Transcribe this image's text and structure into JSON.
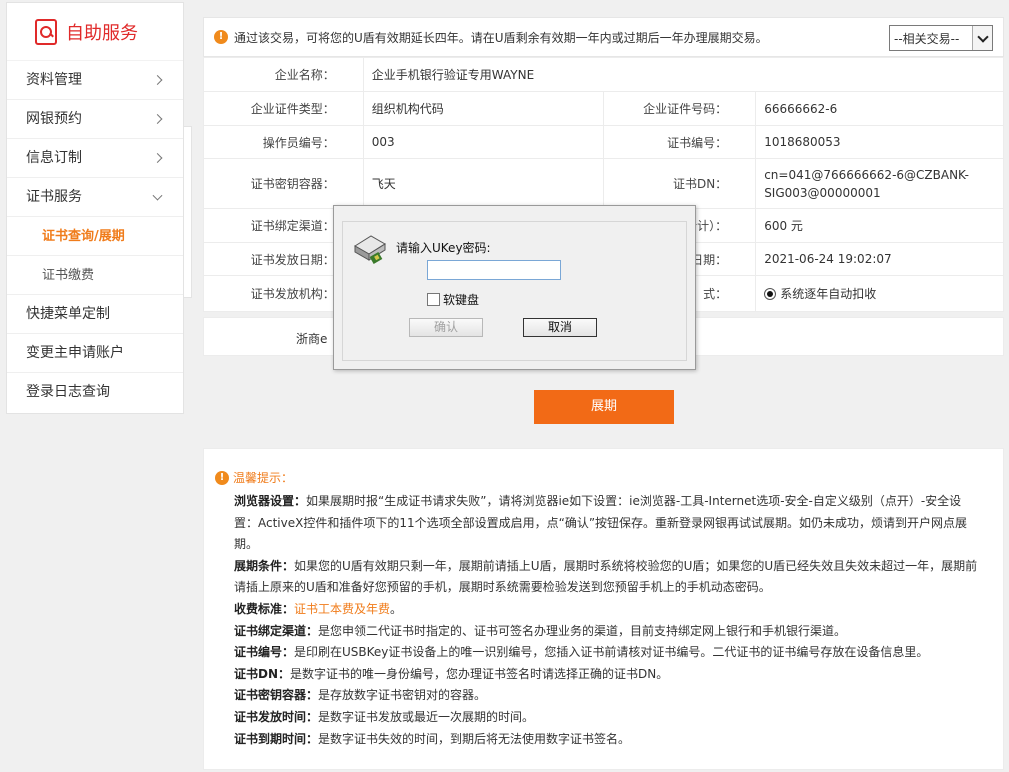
{
  "sidebar": {
    "title": "自助服务",
    "items": [
      {
        "label": "资料管理",
        "chevron": "right"
      },
      {
        "label": "网银预约",
        "chevron": "right"
      },
      {
        "label": "信息订制",
        "chevron": "right"
      },
      {
        "label": "证书服务",
        "chevron": "down"
      },
      {
        "label": "证书查询/展期",
        "sub": true,
        "active": true
      },
      {
        "label": "证书缴费",
        "sub": true
      },
      {
        "label": "快捷菜单定制"
      },
      {
        "label": "变更主申请账户"
      },
      {
        "label": "登录日志查询"
      }
    ]
  },
  "notice": {
    "text": "通过该交易，可将您的U盾有效期延长四年。请在U盾剩余有效期一年内或过期后一年办理展期交易。",
    "select_value": "--相关交易--"
  },
  "info": {
    "company_name_label": "企业名称：",
    "company_name": "企业手机银行验证专用WAYNE",
    "cert_type_label": "企业证件类型：",
    "cert_type": "组织机构代码",
    "cert_no_label": "企业证件号码：",
    "cert_no": "66666662-6",
    "operator_label": "操作员编号：",
    "operator": "003",
    "cert_id_label": "证书编号：",
    "cert_id": "1018680053",
    "container_label": "证书密钥容器：",
    "container": "飞天",
    "dn_label": "证书DN：",
    "dn_line1": "cn=041@766666662-6@CZBANK-",
    "dn_line2": "SIG003@00000001",
    "channel_label": "证书绑定渠道：",
    "fee_label_partial": "合计）：",
    "fee": "600 元",
    "issue_date_label": "证书发放日期：",
    "expire_label_partial": "日期：",
    "expire_date": "2021-06-24 19:02:07",
    "issuer_label": "证书发放机构：",
    "pay_label_partial": "式：",
    "pay_option": "系统逐年自动扣收"
  },
  "agreement_partial": "浙商e",
  "renew_button": "展期",
  "dialog": {
    "prompt": "请输入UKey密码:",
    "password": "",
    "soft_keyboard": "软键盘",
    "ok": "确认",
    "cancel": "取消"
  },
  "tips": {
    "title": "温馨提示：",
    "p1_head": "浏览器设置：",
    "p1_body": "如果展期时报“生成证书请求失败”，请将浏览器ie如下设置：ie浏览器-工具-Internet选项-安全-自定义级别（点开）-安全设置：ActiveX控件和插件项下的11个选项全部设置成启用，点“确认”按钮保存。重新登录网银再试试展期。如仍未成功，烦请到开户网点展期。",
    "p2_head": "展期条件：",
    "p2_body": "如果您的U盾有效期只剩一年，展期前请插上U盾，展期时系统将校验您的U盾；如果您的U盾已经失效且失效未超过一年，展期前请插上原来的U盾和准备好您预留的手机，展期时系统需要检验发送到您预留手机上的手机动态密码。",
    "p3_head": "收费标准：",
    "p3_link": "证书工本费及年费",
    "p3_tail": "。",
    "p4_head": "证书绑定渠道：",
    "p4_body": "是您申领二代证书时指定的、证书可签名办理业务的渠道，目前支持绑定网上银行和手机银行渠道。",
    "p5_head": "证书编号：",
    "p5_body": "是印刷在USBKey证书设备上的唯一识别编号，您插入证书前请核对证书编号。二代证书的证书编号存放在设备信息里。",
    "p6_head": "证书DN：",
    "p6_body": "是数字证书的唯一身份编号，您办理证书签名时请选择正确的证书DN。",
    "p7_head": "证书密钥容器：",
    "p7_body": "是存放数字证书密钥对的容器。",
    "p8_head": "证书发放时间：",
    "p8_body": "是数字证书发放或最近一次展期的时间。",
    "p9_head": "证书到期时间：",
    "p9_body": "是数字证书失效的时间，到期后将无法使用数字证书签名。"
  },
  "colors": {
    "brand_red": "#e02a2a",
    "accent_orange": "#f26a16",
    "tip_orange": "#f07c1b"
  }
}
